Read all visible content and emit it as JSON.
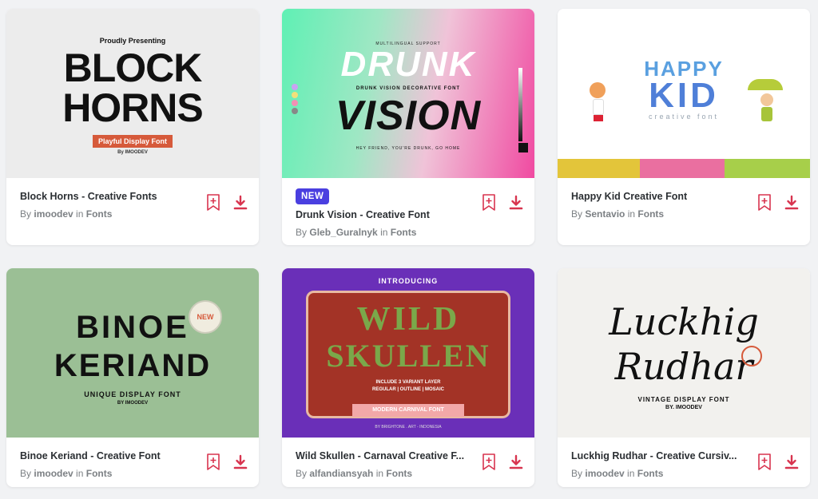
{
  "colors": {
    "accent": "#d8344f",
    "badge": "#4a3fe0",
    "title": "#2b2f33",
    "muted": "#7c8084"
  },
  "cards": [
    {
      "title": "Block Horns - Creative Fonts",
      "author": "imoodev",
      "category": "Fonts",
      "by_prefix": "By",
      "in_word": "in",
      "preview": {
        "top": "Proudly Presenting",
        "line1": "BLOCK",
        "line2": "HORNS",
        "tag": "Playful Display Font",
        "credit": "By IMOODEV"
      }
    },
    {
      "badge": "NEW",
      "title": "Drunk Vision - Creative Font",
      "author": "Gleb_Guralnyk",
      "category": "Fonts",
      "by_prefix": "By",
      "in_word": "in",
      "preview": {
        "top": "MULTILINGUAL SUPPORT",
        "line1": "DRUNK",
        "sub": "DRUNK VISION DECORATIVE FONT",
        "line2": "VISION",
        "bottom": "HEY FRIEND, YOU'RE DRUNK, GO HOME"
      }
    },
    {
      "title": "Happy Kid Creative Font",
      "author": "Sentavio",
      "category": "Fonts",
      "by_prefix": "By",
      "in_word": "in",
      "preview": {
        "line1": "HAPPY",
        "line2": "KID",
        "sub": "creative font"
      }
    },
    {
      "title": "Binoe Keriand - Creative Font",
      "author": "imoodev",
      "category": "Fonts",
      "by_prefix": "By",
      "in_word": "in",
      "preview": {
        "line1": "BINOE",
        "line2": "KERIAND",
        "tag": "UNIQUE DISPLAY FONT",
        "credit": "BY IMOODEV",
        "seal": "NEW"
      }
    },
    {
      "title": "Wild Skullen - Carnaval Creative F...",
      "author": "alfandiansyah",
      "category": "Fonts",
      "by_prefix": "By",
      "in_word": "in",
      "preview": {
        "top": "INTRODUCING",
        "line1": "WILD",
        "line2": "SKULLEN",
        "sub1": "INCLUDE 3 VARIANT LAYER",
        "sub2": "REGULAR | OUTLINE | MOSAIC",
        "ribbon": "MODERN CARNIVAL FONT",
        "credit": "BY BRIGHTONE . ART - INDONESIA"
      }
    },
    {
      "title": "Luckhig Rudhar - Creative Cursiv...",
      "author": "imoodev",
      "category": "Fonts",
      "by_prefix": "By",
      "in_word": "in",
      "preview": {
        "line1": "Luckhig",
        "line2": "Rudhar",
        "tag": "VINTAGE DISPLAY FONT",
        "credit": "BY. IMOODEV"
      }
    }
  ]
}
